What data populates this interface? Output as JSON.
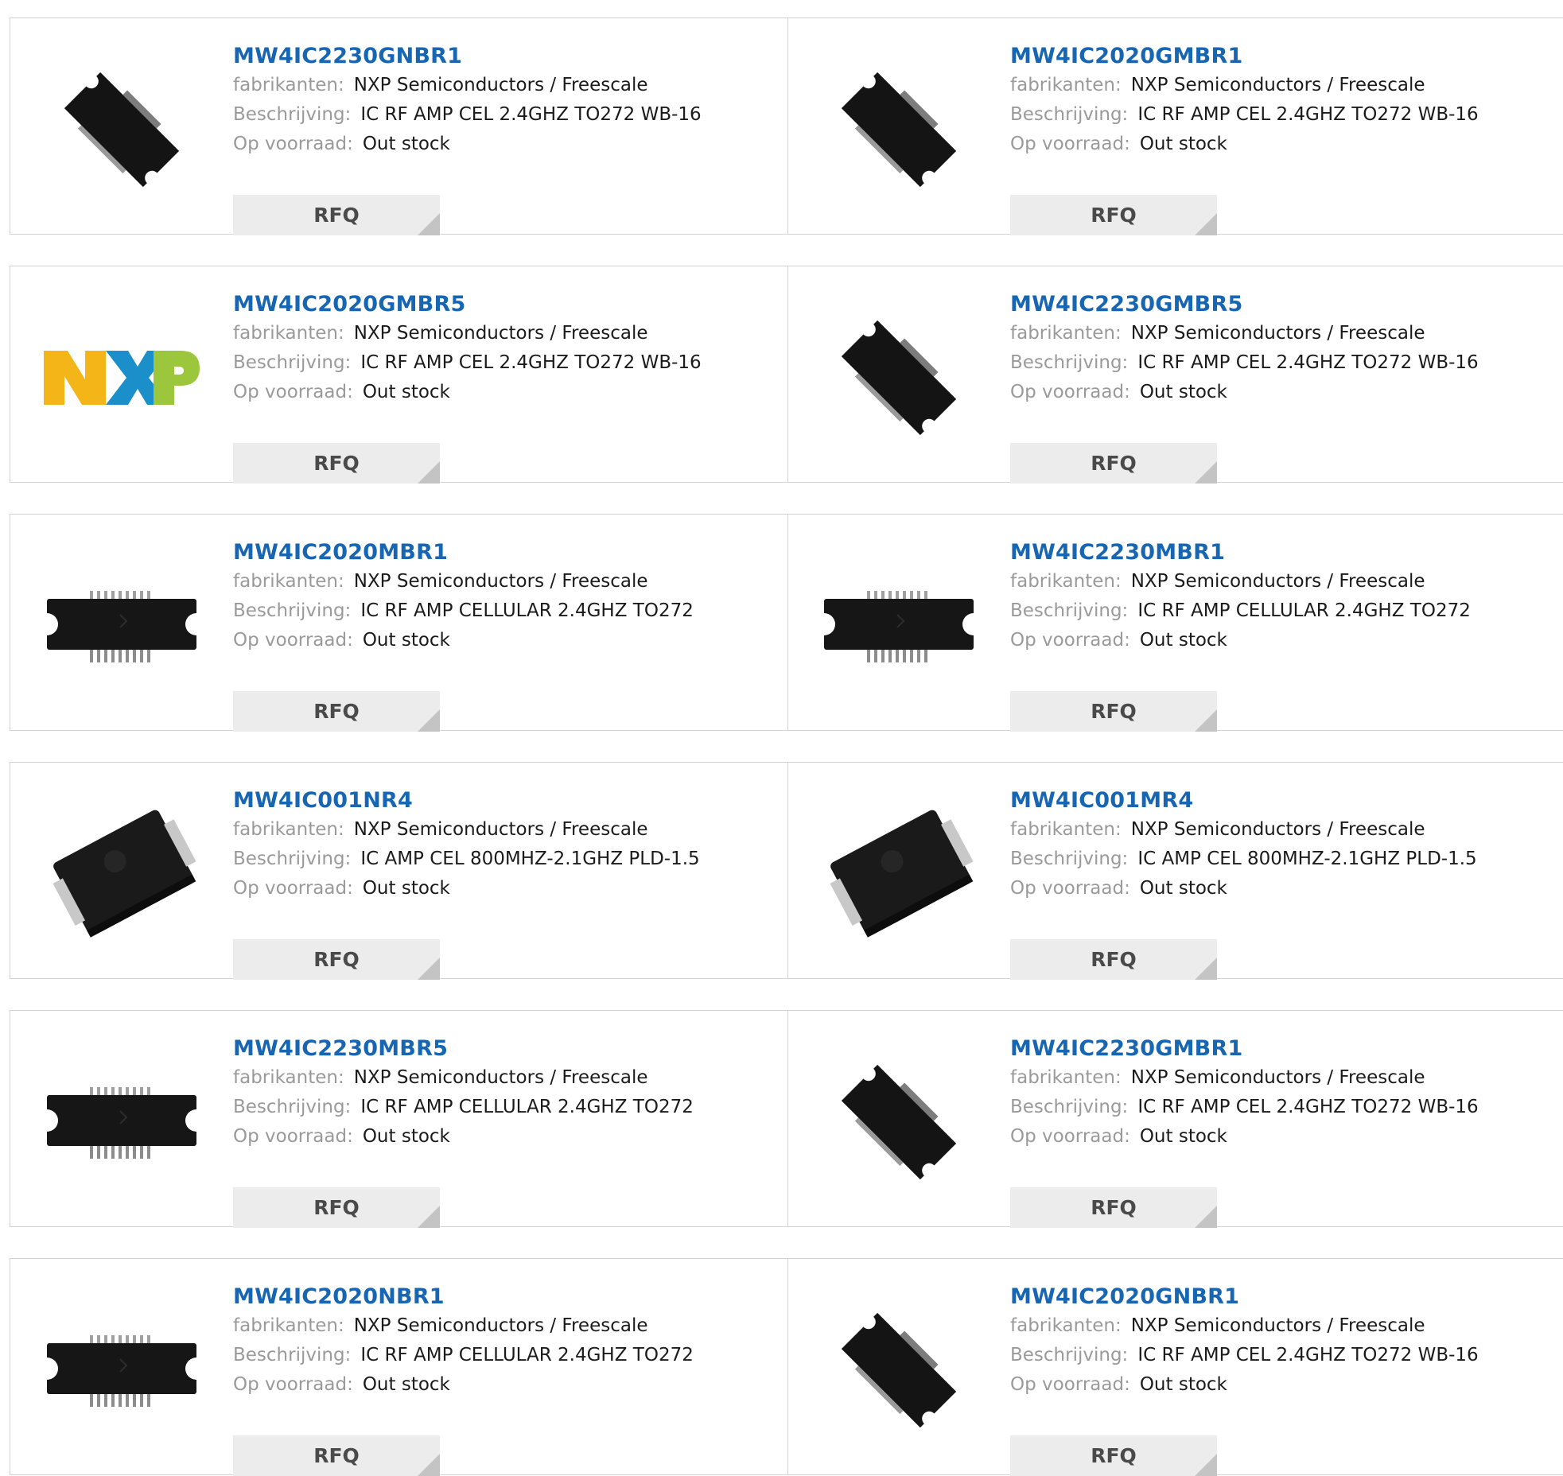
{
  "labels": {
    "manufacturer": "fabrikanten:",
    "description": "Beschrijving:",
    "stock": "Op voorraad:",
    "rfq": "RFQ"
  },
  "products": [
    {
      "pn": "MW4IC2230GNBR1",
      "manufacturer": "NXP Semiconductors / Freescale",
      "description": "IC RF AMP CEL 2.4GHZ TO272 WB-16",
      "stock": "Out stock",
      "image": "chip-diagonal"
    },
    {
      "pn": "MW4IC2020GMBR1",
      "manufacturer": "NXP Semiconductors / Freescale",
      "description": "IC RF AMP CEL 2.4GHZ TO272 WB-16",
      "stock": "Out stock",
      "image": "chip-diagonal"
    },
    {
      "pn": "MW4IC2020GMBR5",
      "manufacturer": "NXP Semiconductors / Freescale",
      "description": "IC RF AMP CEL 2.4GHZ TO272 WB-16",
      "stock": "Out stock",
      "image": "nxp-logo"
    },
    {
      "pn": "MW4IC2230GMBR5",
      "manufacturer": "NXP Semiconductors / Freescale",
      "description": "IC RF AMP CEL 2.4GHZ TO272 WB-16",
      "stock": "Out stock",
      "image": "chip-diagonal"
    },
    {
      "pn": "MW4IC2020MBR1",
      "manufacturer": "NXP Semiconductors / Freescale",
      "description": "IC RF AMP CELLULAR 2.4GHZ TO272",
      "stock": "Out stock",
      "image": "chip-flat"
    },
    {
      "pn": "MW4IC2230MBR1",
      "manufacturer": "NXP Semiconductors / Freescale",
      "description": "IC RF AMP CELLULAR 2.4GHZ TO272",
      "stock": "Out stock",
      "image": "chip-flat"
    },
    {
      "pn": "MW4IC001NR4",
      "manufacturer": "NXP Semiconductors / Freescale",
      "description": "IC AMP CEL 800MHZ-2.1GHZ PLD-1.5",
      "stock": "Out stock",
      "image": "chip-pld"
    },
    {
      "pn": "MW4IC001MR4",
      "manufacturer": "NXP Semiconductors / Freescale",
      "description": "IC AMP CEL 800MHZ-2.1GHZ PLD-1.5",
      "stock": "Out stock",
      "image": "chip-pld"
    },
    {
      "pn": "MW4IC2230MBR5",
      "manufacturer": "NXP Semiconductors / Freescale",
      "description": "IC RF AMP CELLULAR 2.4GHZ TO272",
      "stock": "Out stock",
      "image": "chip-flat"
    },
    {
      "pn": "MW4IC2230GMBR1",
      "manufacturer": "NXP Semiconductors / Freescale",
      "description": "IC RF AMP CEL 2.4GHZ TO272 WB-16",
      "stock": "Out stock",
      "image": "chip-diagonal"
    },
    {
      "pn": "MW4IC2020NBR1",
      "manufacturer": "NXP Semiconductors / Freescale",
      "description": "IC RF AMP CELLULAR 2.4GHZ TO272",
      "stock": "Out stock",
      "image": "chip-flat"
    },
    {
      "pn": "MW4IC2020GNBR1",
      "manufacturer": "NXP Semiconductors / Freescale",
      "description": "IC RF AMP CEL 2.4GHZ TO272 WB-16",
      "stock": "Out stock",
      "image": "chip-diagonal"
    }
  ],
  "colors": {
    "part_number_link": "#1766b3",
    "label_gray": "#9a9a9a",
    "value_text": "#1b1b1b",
    "rfq_bg": "#ececec",
    "border": "#d4d4d4"
  }
}
